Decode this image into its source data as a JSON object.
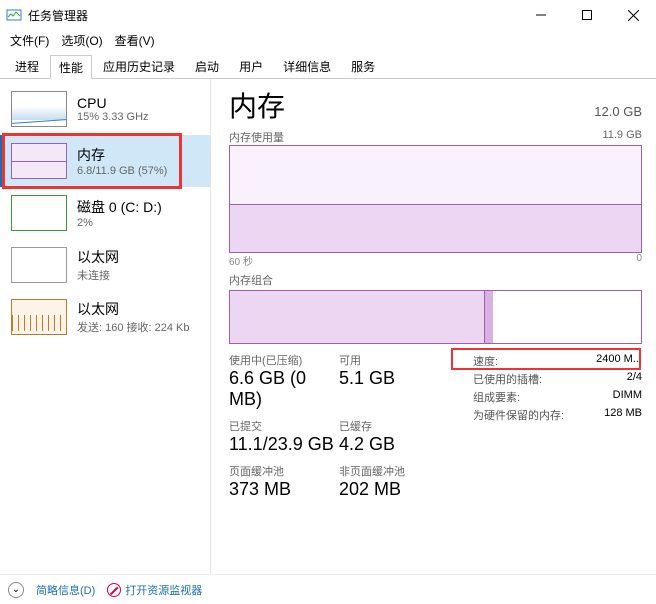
{
  "window": {
    "title": "任务管理器"
  },
  "menu": {
    "file": "文件(F)",
    "file_u": "F",
    "options": "选项(O)",
    "options_u": "O",
    "view": "查看(V)",
    "view_u": "V"
  },
  "tabs": {
    "processes": "进程",
    "performance": "性能",
    "history": "应用历史记录",
    "startup": "启动",
    "users": "用户",
    "details": "详细信息",
    "services": "服务"
  },
  "sidebar": {
    "cpu": {
      "title": "CPU",
      "sub": "15% 3.33 GHz"
    },
    "memory": {
      "title": "内存",
      "sub": "6.8/11.9 GB (57%)"
    },
    "disk": {
      "title": "磁盘 0 (C: D:)",
      "sub": "2%"
    },
    "eth1": {
      "title": "以太网",
      "sub": "未连接"
    },
    "eth2": {
      "title": "以太网",
      "sub": "发送: 160 接收: 224 Kb"
    }
  },
  "main": {
    "title": "内存",
    "total": "12.0 GB",
    "usage_label": "内存使用量",
    "usage_max": "11.9 GB",
    "axis_left": "60 秒",
    "axis_right": "0",
    "composition_label": "内存组合",
    "stats": {
      "inuse_label": "使用中(已压缩)",
      "inuse_value": "6.6 GB (0 MB)",
      "avail_label": "可用",
      "avail_value": "5.1 GB",
      "committed_label": "已提交",
      "committed_value": "11.1/23.9 GB",
      "cached_label": "已缓存",
      "cached_value": "4.2 GB",
      "paged_label": "页面缓冲池",
      "paged_value": "373 MB",
      "nonpaged_label": "非页面缓冲池",
      "nonpaged_value": "202 MB"
    },
    "right": {
      "speed_label": "速度:",
      "speed_value": "2400 M...",
      "slots_label": "已使用的插槽:",
      "slots_value": "2/4",
      "form_label": "组成要素:",
      "form_value": "DIMM",
      "reserved_label": "为硬件保留的内存:",
      "reserved_value": "128 MB"
    }
  },
  "footer": {
    "simple": "简略信息(D)",
    "resmon": "打开资源监视器"
  },
  "chart_data": {
    "type": "area",
    "title": "内存使用量",
    "ylim": [
      0,
      11.9
    ],
    "x_span_seconds": 60,
    "approx_value_gb": 6.8
  }
}
